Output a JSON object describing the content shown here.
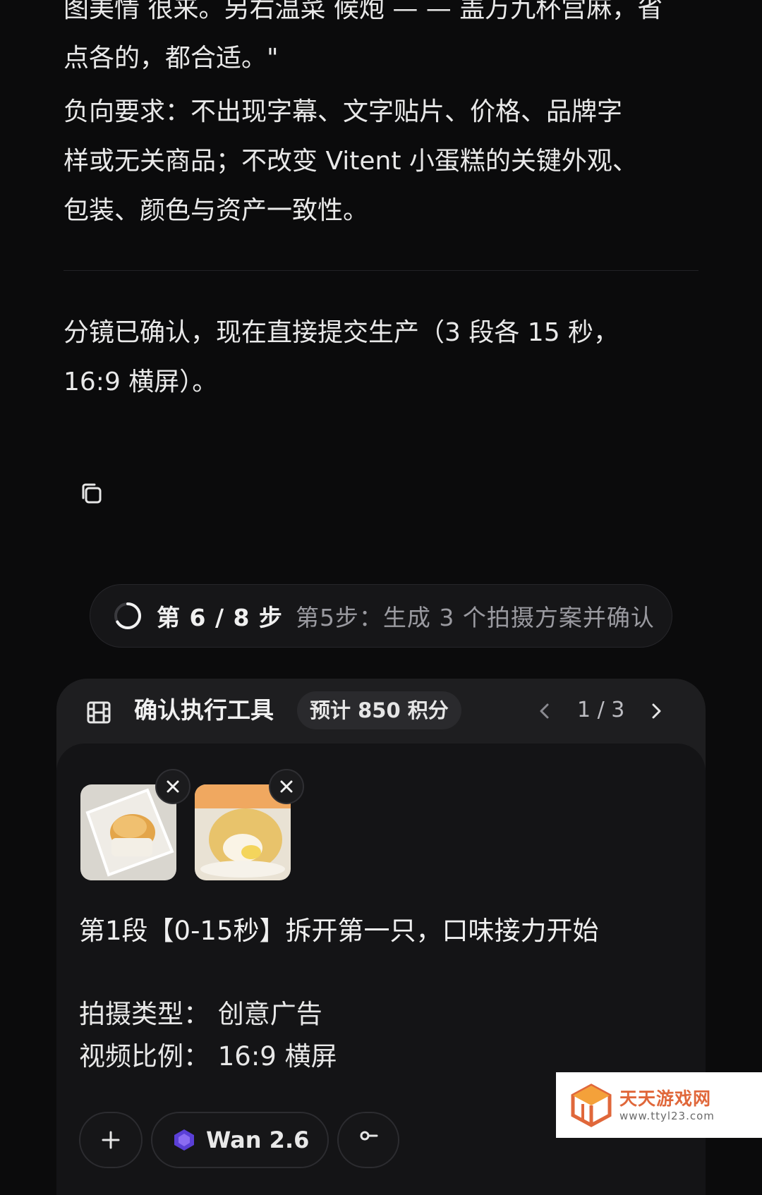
{
  "messages": {
    "cutoff_line1": "图美情 很来。另右温菜 候炮 — — 盖万九杯宫麻，省",
    "cutoff_line2": "点各的，都合适。\"",
    "negative_line1": "负向要求：不出现字幕、文字贴片、价格、品牌字",
    "negative_line2": "样或无关商品；不改变 Vitent 小蛋糕的关键外观、",
    "negative_line3": "包装、颜色与资产一致性。",
    "confirm_line1": "分镜已确认，现在直接提交生产（3 段各 15 秒，",
    "confirm_line2": "16:9 横屏）。"
  },
  "icons": {
    "copy": "copy-icon",
    "spinner": "loading-spinner-icon",
    "film": "film-icon",
    "prev": "chevron-left-icon",
    "next": "chevron-right-icon",
    "remove": "close-icon",
    "add": "plus-icon"
  },
  "progress": {
    "step_count": "第 6 / 8 步",
    "step_desc": "第5步：生成 3 个拍摄方案并确认"
  },
  "card": {
    "title": "确认执行工具",
    "cost_badge": "预计 850 积分",
    "pager": "1 / 3",
    "segment_title": "第1段【0-15秒】拆开第一只，口味接力开始",
    "shoot_type": "拍摄类型：  创意广告",
    "ratio": "视频比例：  16:9 横屏",
    "chips": {
      "model_label": "Wan 2.6"
    }
  },
  "watermark": {
    "name": "天天游戏网",
    "url": "www.ttyl23.com"
  },
  "colors": {
    "background": "#0b0b0c",
    "card": "#1e1e20",
    "watermark_orange": "#e0673a"
  }
}
